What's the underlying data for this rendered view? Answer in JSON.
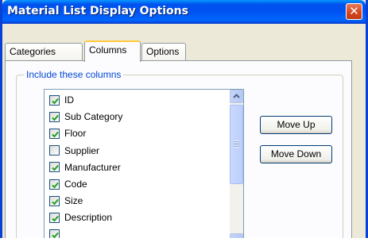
{
  "window": {
    "title": "Material List Display Options",
    "close_icon": "close-icon"
  },
  "tabs": [
    {
      "label": "Categories",
      "active": false
    },
    {
      "label": "Columns",
      "active": true
    },
    {
      "label": "Options",
      "active": false
    }
  ],
  "group": {
    "legend": "Include these columns"
  },
  "columns_list": {
    "items": [
      {
        "label": "ID",
        "checked": true
      },
      {
        "label": "Sub Category",
        "checked": true
      },
      {
        "label": "Floor",
        "checked": true
      },
      {
        "label": "Supplier",
        "checked": false
      },
      {
        "label": "Manufacturer",
        "checked": true
      },
      {
        "label": "Code",
        "checked": true
      },
      {
        "label": "Size",
        "checked": true
      },
      {
        "label": "Description",
        "checked": true
      },
      {
        "label": "",
        "checked": true
      }
    ]
  },
  "buttons": {
    "move_up": "Move Up",
    "move_down": "Move Down"
  },
  "colors": {
    "title_bar": "#0053ee",
    "accent_blue": "#0046d5",
    "close": "#d6471f",
    "tab_highlight": "#ffc83c"
  }
}
